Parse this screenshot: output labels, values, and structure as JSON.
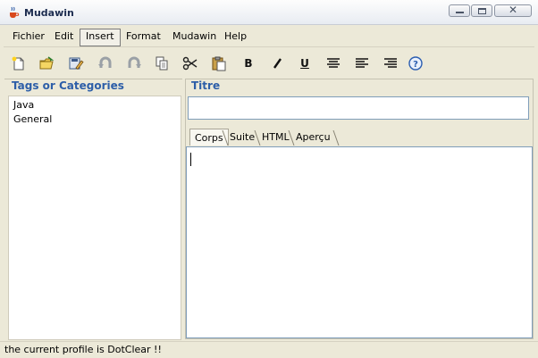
{
  "window": {
    "title": "Mudawin"
  },
  "menu": {
    "items": [
      "Fichier",
      "Edit",
      "Insert",
      "Format",
      "Mudawin",
      "Help"
    ],
    "active": "Insert"
  },
  "toolbar": {
    "items": [
      {
        "name": "new-document-icon"
      },
      {
        "name": "open-folder-icon"
      },
      {
        "name": "save-edit-icon"
      },
      {
        "name": "undo-icon"
      },
      {
        "name": "redo-icon"
      },
      {
        "name": "copy-icon"
      },
      {
        "name": "cut-scissors-icon"
      },
      {
        "name": "paste-clipboard-icon"
      },
      {
        "name": "bold-icon",
        "label": "B"
      },
      {
        "name": "italic-icon"
      },
      {
        "name": "underline-icon",
        "label": "U"
      },
      {
        "name": "align-center-icon"
      },
      {
        "name": "align-left-icon"
      },
      {
        "name": "align-right-icon"
      },
      {
        "name": "help-icon"
      }
    ]
  },
  "left_panel": {
    "legend": "Tags or Categories",
    "items": [
      "Java",
      "General"
    ]
  },
  "right_panel": {
    "title_legend": "Titre",
    "title_value": "",
    "tabs": [
      "Corps",
      "Suite",
      "HTML",
      "Aperçu"
    ],
    "active_tab": "Corps",
    "body_value": ""
  },
  "status": {
    "text": "the current profile is DotClear !!"
  },
  "colors": {
    "legend": "#2d5ea8",
    "window_bg": "#ece9d8",
    "field_border": "#7f9db9"
  }
}
